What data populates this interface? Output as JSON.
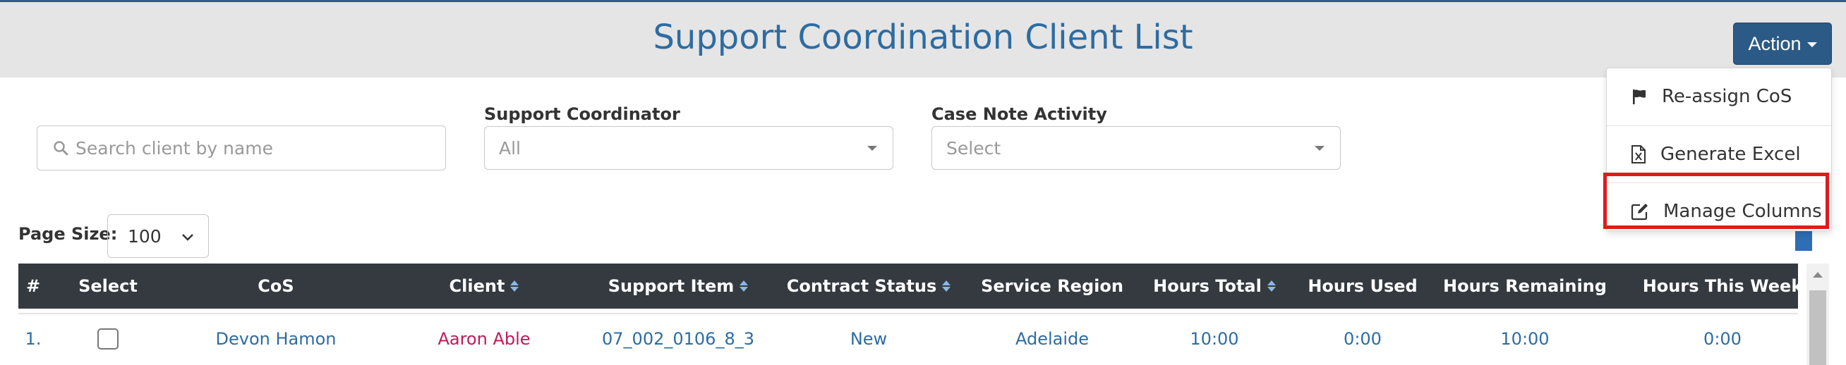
{
  "header": {
    "title": "Support Coordination Client List",
    "action_label": "Action"
  },
  "action_menu": {
    "items": [
      {
        "label": "Re-assign CoS",
        "icon": "flag-icon"
      },
      {
        "label": "Generate Excel",
        "icon": "excel-file-icon"
      },
      {
        "label": "Manage Columns",
        "icon": "edit-icon"
      }
    ],
    "highlighted_item": "Manage Columns",
    "highlight_color": "#e01b1b"
  },
  "filters": {
    "search_placeholder": "Search client by name",
    "support_coordinator_label": "Support Coordinator",
    "support_coordinator_value": "All",
    "case_note_label": "Case Note Activity",
    "case_note_value": "Select"
  },
  "page_size": {
    "label": "Page Size:",
    "value": "100"
  },
  "table": {
    "columns": [
      {
        "label": "#",
        "sortable": false
      },
      {
        "label": "Select",
        "sortable": false
      },
      {
        "label": "CoS",
        "sortable": false
      },
      {
        "label": "Client",
        "sortable": true
      },
      {
        "label": "Support Item",
        "sortable": true
      },
      {
        "label": "Contract Status",
        "sortable": true
      },
      {
        "label": "Service Region",
        "sortable": false
      },
      {
        "label": "Hours Total",
        "sortable": true
      },
      {
        "label": "Hours Used",
        "sortable": false
      },
      {
        "label": "Hours Remaining",
        "sortable": false
      },
      {
        "label": "Hours This Week",
        "sortable": false
      }
    ],
    "rows": [
      {
        "num": "1.",
        "selected": false,
        "cos": "Devon Hamon",
        "client": "Aaron Able",
        "support_item": "07_002_0106_8_3",
        "contract_status": "New",
        "service_region": "Adelaide",
        "hours_total": "10:00",
        "hours_used": "0:00",
        "hours_remaining": "10:00",
        "hours_this_week": "0:00"
      }
    ]
  },
  "colors": {
    "title": "#2d6ca2",
    "action_button": "#2b5a86",
    "table_header": "#343a40",
    "link": "#2d6ca2",
    "client_link": "#c2185b"
  }
}
